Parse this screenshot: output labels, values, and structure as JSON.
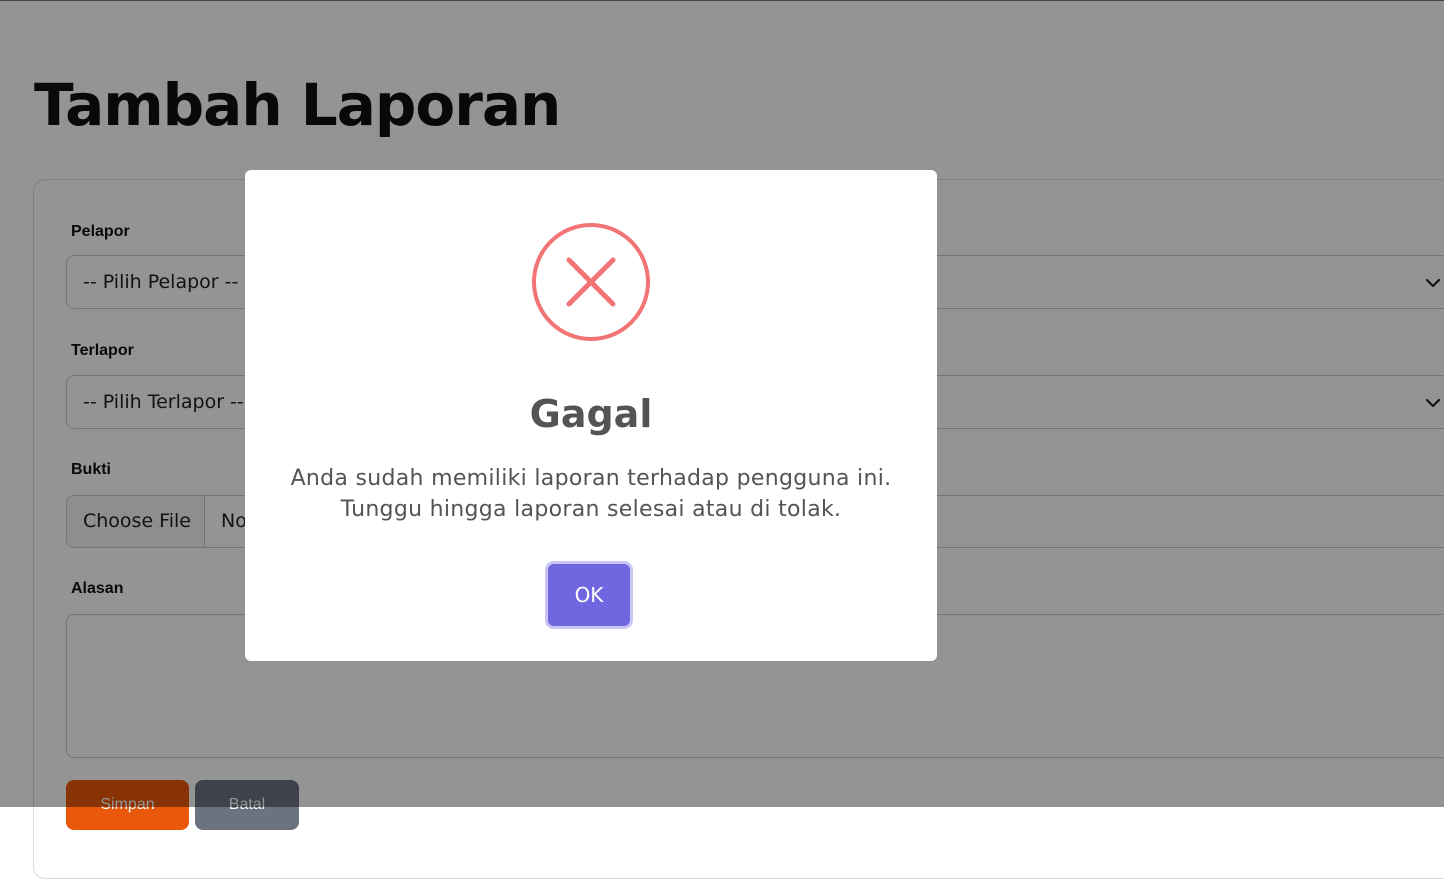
{
  "page": {
    "title": "Tambah Laporan"
  },
  "form": {
    "pelapor_label": "Pelapor",
    "pelapor_value": "-- Pilih Pelapor --",
    "terlapor_label": "Terlapor",
    "terlapor_value": "-- Pilih Terlapor --",
    "bukti_label": "Bukti",
    "file_button": "Choose File",
    "file_status": "No file chosen",
    "alasan_label": "Alasan",
    "alasan_value": "",
    "save_label": "Simpan",
    "cancel_label": "Batal"
  },
  "modal": {
    "icon": "error-x-icon",
    "title": "Gagal",
    "message_line1": "Anda sudah memiliki laporan terhadap pengguna ini.",
    "message_line2": "Tunggu hingga laporan selesai atau di tolak.",
    "ok_label": "OK"
  },
  "colors": {
    "error_red": "#f27474",
    "confirm_purple": "#7066e0",
    "save_orange": "#ea580c",
    "cancel_gray": "#6b7280"
  }
}
